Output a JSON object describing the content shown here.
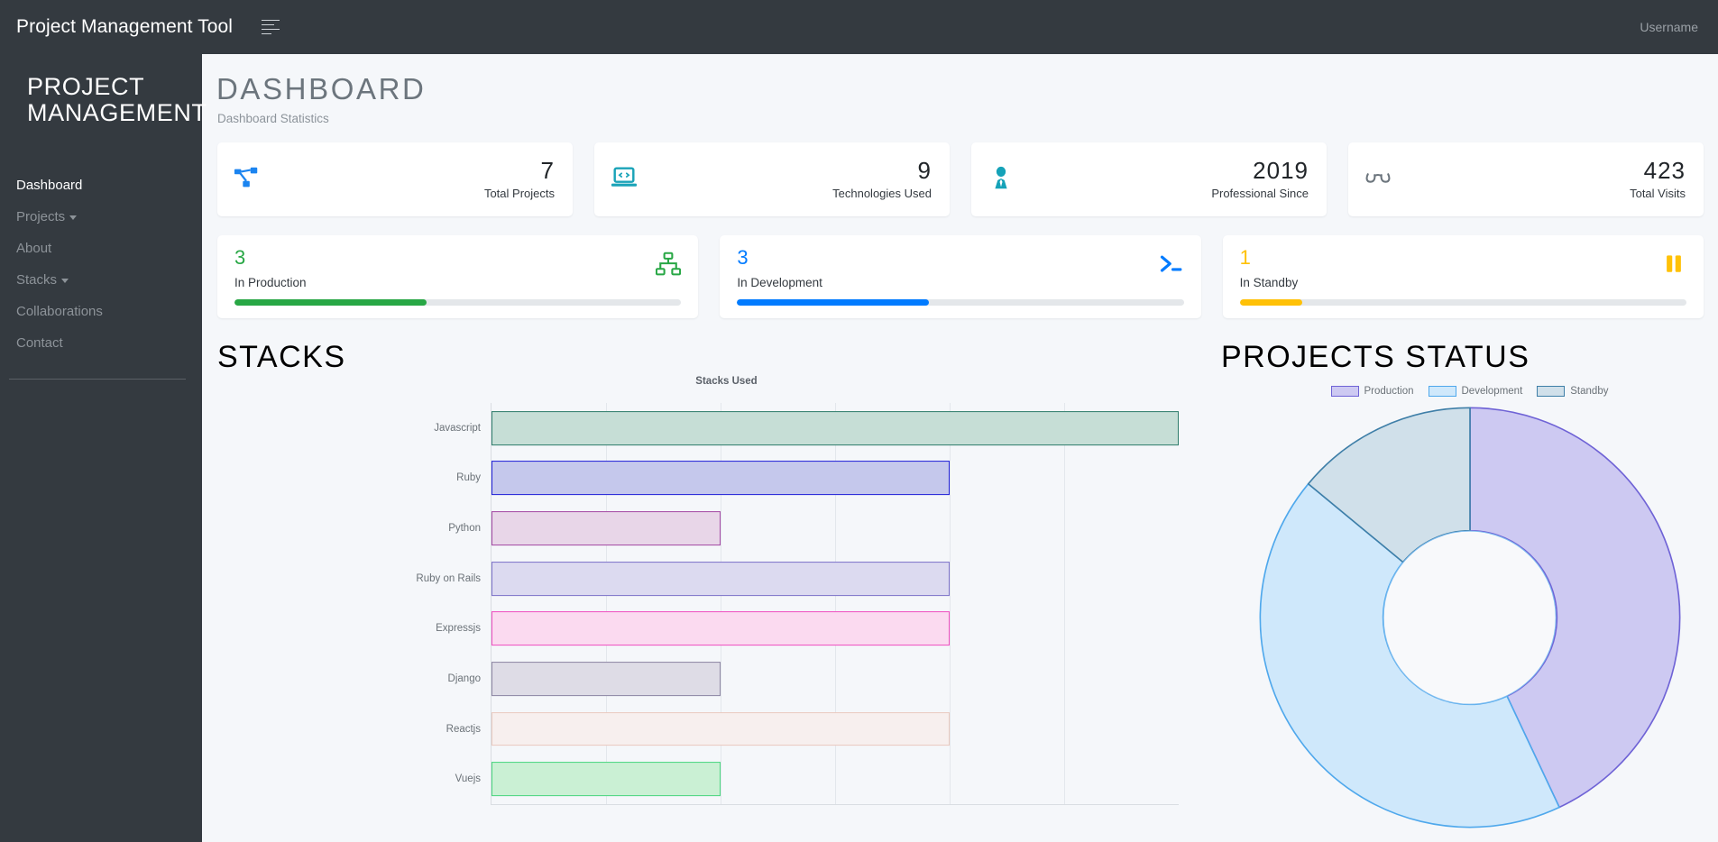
{
  "topbar": {
    "brand": "Project Management Tool",
    "menu_icon": "hamburger-icon",
    "username": "Username"
  },
  "sidebar": {
    "title": "PROJECT MANAGEMENT",
    "items": [
      {
        "label": "Dashboard",
        "active": true,
        "caret": false
      },
      {
        "label": "Projects",
        "active": false,
        "caret": true
      },
      {
        "label": "About",
        "active": false,
        "caret": false
      },
      {
        "label": "Stacks",
        "active": false,
        "caret": true
      },
      {
        "label": "Collaborations",
        "active": false,
        "caret": false
      },
      {
        "label": "Contact",
        "active": false,
        "caret": false
      }
    ]
  },
  "header": {
    "title": "DASHBOARD",
    "subtitle": "Dashboard Statistics"
  },
  "stats": [
    {
      "value": "7",
      "label": "Total Projects",
      "icon": "sitemap-icon",
      "color": "#1b84f0"
    },
    {
      "value": "9",
      "label": "Technologies Used",
      "icon": "laptop-code-icon",
      "color": "#1aa3b8"
    },
    {
      "value": "2019",
      "label": "Professional Since",
      "icon": "user-tie-icon",
      "color": "#15a2b8"
    },
    {
      "value": "423",
      "label": "Total Visits",
      "icon": "glasses-icon",
      "color": "#6c757d"
    }
  ],
  "progress": [
    {
      "value": "3",
      "label": "In Production",
      "percent": 43,
      "icon": "network-icon",
      "color": "#28a745"
    },
    {
      "value": "3",
      "label": "In Development",
      "percent": 43,
      "icon": "terminal-icon",
      "color": "#007bff"
    },
    {
      "value": "1",
      "label": "In Standby",
      "percent": 14,
      "icon": "pause-icon",
      "color": "#ffc107"
    }
  ],
  "stacks_section": {
    "heading": "STACKS"
  },
  "status_section": {
    "heading": "PROJECTS STATUS"
  },
  "chart_data": [
    {
      "type": "bar",
      "orientation": "horizontal",
      "title": "Stacks Used",
      "xlabel": "",
      "ylabel": "",
      "xlim": [
        0,
        6
      ],
      "grid": true,
      "gridlines": [
        1,
        2,
        3,
        4,
        5
      ],
      "categories": [
        "Javascript",
        "Ruby",
        "Python",
        "Ruby on Rails",
        "Expressjs",
        "Django",
        "Reactjs",
        "Vuejs"
      ],
      "values": [
        6,
        4,
        2,
        4,
        4,
        2,
        4,
        2
      ],
      "colors": [
        {
          "fill": "#c6ded6",
          "border": "#2f7d6c"
        },
        {
          "fill": "#c5c8ec",
          "border": "#2020d8"
        },
        {
          "fill": "#e8d6e8",
          "border": "#a349a4"
        },
        {
          "fill": "#dcdaf0",
          "border": "#7d72c9"
        },
        {
          "fill": "#fbdaf0",
          "border": "#ef4fc0"
        },
        {
          "fill": "#dedce6",
          "border": "#8d86a3"
        },
        {
          "fill": "#f7efee",
          "border": "#e8c9bf"
        },
        {
          "fill": "#caf0d4",
          "border": "#4ad57f"
        }
      ]
    },
    {
      "type": "pie",
      "variant": "donut",
      "title": "",
      "legend_position": "top",
      "labels": [
        "Production",
        "Development",
        "Standby"
      ],
      "values": [
        43,
        43,
        14
      ],
      "colors": [
        "#cdc9f2",
        "#cfe8fb",
        "#d0e0ea"
      ],
      "borders": [
        "#6f63d6",
        "#4fa8ec",
        "#3f7fa8"
      ]
    }
  ]
}
